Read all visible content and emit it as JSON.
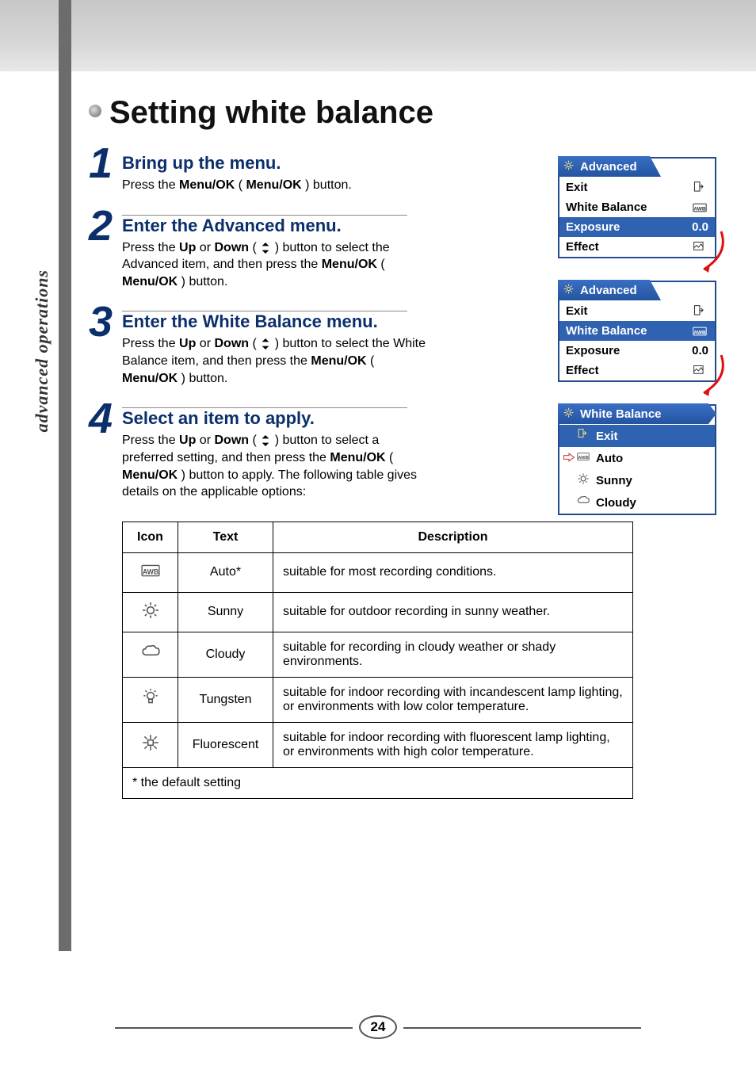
{
  "side_label": "advanced operations",
  "page_title": "Setting white balance",
  "steps": [
    {
      "num": "1",
      "title": "Bring up the menu.",
      "body_parts": [
        "Press the ",
        "Menu/OK",
        " ( ",
        "MENUOK",
        " ) button."
      ]
    },
    {
      "num": "2",
      "title": "Enter the Advanced menu.",
      "body_parts": [
        "Press the ",
        "Up",
        " or ",
        "Down",
        " ( ",
        "UPDOWN",
        " ) button to select the Advanced item, and then press the ",
        "Menu/OK",
        " ( ",
        "MENUOK",
        " ) button."
      ]
    },
    {
      "num": "3",
      "title": "Enter the White Balance menu.",
      "body_parts": [
        "Press the ",
        "Up",
        " or ",
        "Down",
        " ( ",
        "UPDOWN",
        " ) button to select the White Balance item, and then press the ",
        "Menu/OK",
        " ( ",
        "MENUOK",
        " ) button."
      ]
    },
    {
      "num": "4",
      "title": "Select an item to apply.",
      "body_parts": [
        "Press the ",
        "Up",
        " or ",
        "Down",
        " ( ",
        "UPDOWN",
        " ) button to select a preferred setting, and then press the ",
        "Menu/OK",
        " ( ",
        "MENUOK",
        " ) button to apply. The following table gives details on the applicable options:"
      ]
    }
  ],
  "menu1": {
    "tab": "Advanced",
    "rows": [
      {
        "label": "Exit",
        "value_icon": "exit",
        "selected": false
      },
      {
        "label": "White Balance",
        "value_icon": "awb",
        "selected": false
      },
      {
        "label": "Exposure",
        "value_text": "0.0",
        "selected": true
      },
      {
        "label": "Effect",
        "value_icon": "effect",
        "selected": false
      }
    ]
  },
  "menu2": {
    "tab": "Advanced",
    "rows": [
      {
        "label": "Exit",
        "value_icon": "exit",
        "selected": false
      },
      {
        "label": "White Balance",
        "value_icon": "awb",
        "selected": true
      },
      {
        "label": "Exposure",
        "value_text": "0.0",
        "selected": false
      },
      {
        "label": "Effect",
        "value_icon": "effect",
        "selected": false
      }
    ]
  },
  "menu3": {
    "tab": "White Balance",
    "rows": [
      {
        "label": "Exit",
        "icon": "exit",
        "selected": true,
        "arrow": false
      },
      {
        "label": "Auto",
        "icon": "awb",
        "selected": false,
        "arrow": true
      },
      {
        "label": "Sunny",
        "icon": "sunny",
        "selected": false,
        "arrow": false
      },
      {
        "label": "Cloudy",
        "icon": "cloudy",
        "selected": false,
        "arrow": false
      }
    ]
  },
  "table": {
    "headers": [
      "Icon",
      "Text",
      "Description"
    ],
    "rows": [
      {
        "icon": "awb",
        "text": "Auto*",
        "desc": "suitable for most recording conditions."
      },
      {
        "icon": "sunny",
        "text": "Sunny",
        "desc": "suitable for outdoor recording in sunny weather."
      },
      {
        "icon": "cloudy",
        "text": "Cloudy",
        "desc": "suitable for recording in cloudy weather or shady environments."
      },
      {
        "icon": "tungsten",
        "text": "Tungsten",
        "desc": "suitable for indoor recording with incandescent lamp lighting, or environments with low color temperature."
      },
      {
        "icon": "fluorescent",
        "text": "Fluorescent",
        "desc": "suitable for indoor recording with fluorescent lamp lighting, or environments with high color temperature."
      }
    ],
    "footer": "* the default setting"
  },
  "page_number": "24"
}
